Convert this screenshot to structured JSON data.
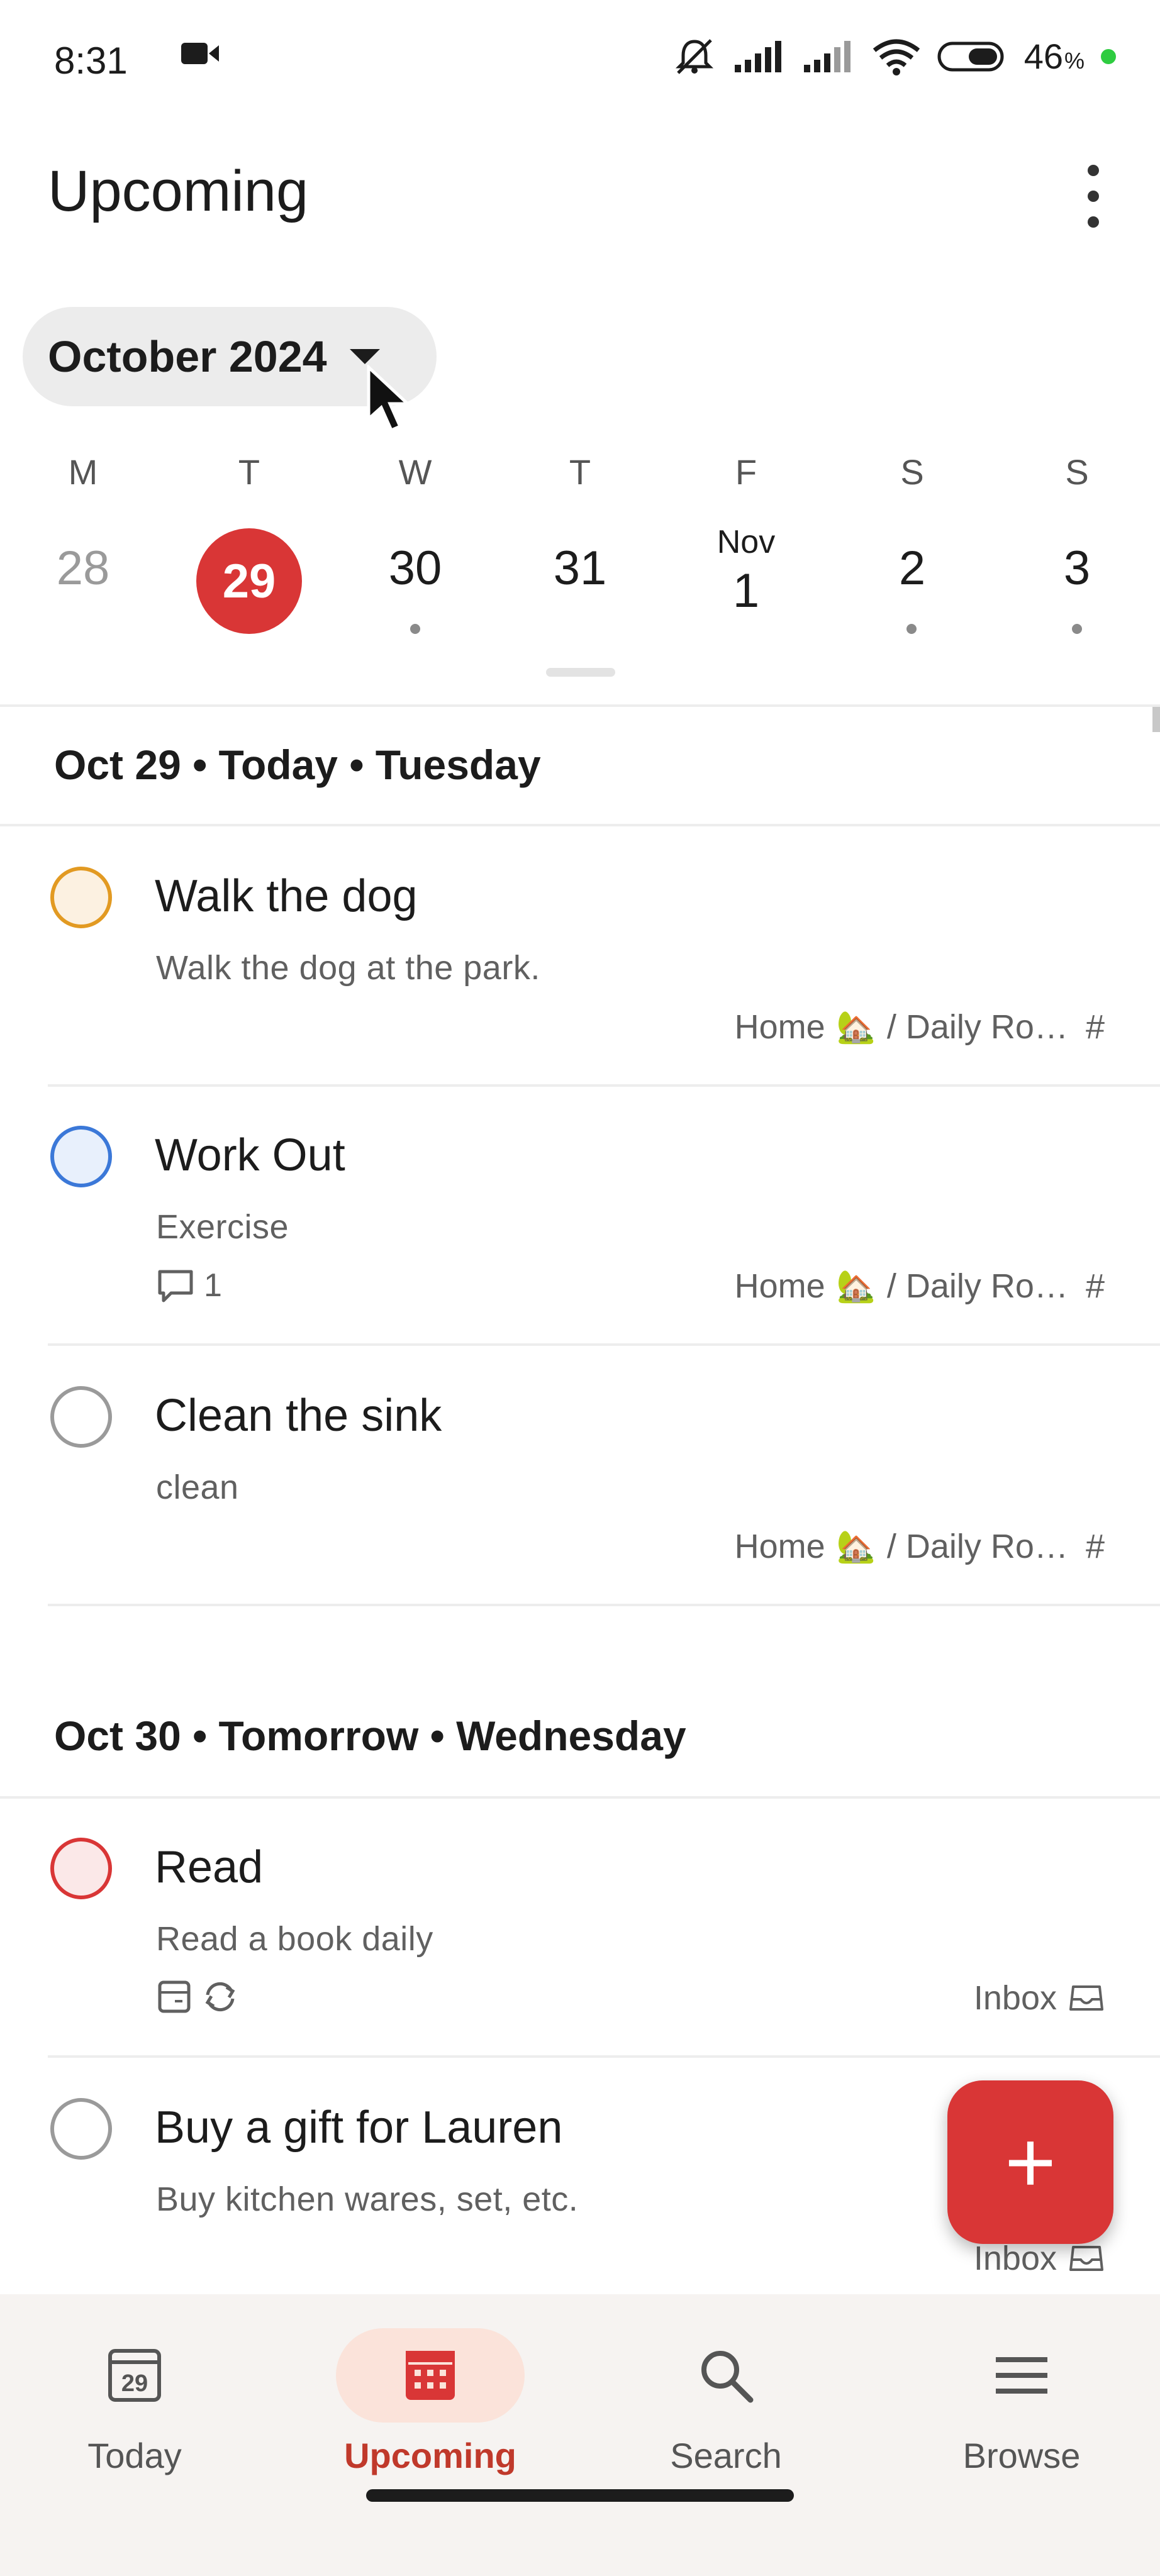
{
  "status_bar": {
    "time": "8:31",
    "battery": "46",
    "battery_unit": "%"
  },
  "header": {
    "title": "Upcoming"
  },
  "month_selector": {
    "label": "October 2024"
  },
  "week": {
    "days": [
      {
        "dow": "M",
        "date": "28"
      },
      {
        "dow": "T",
        "date": "29"
      },
      {
        "dow": "W",
        "date": "30"
      },
      {
        "dow": "T",
        "date": "31"
      },
      {
        "dow": "F",
        "month": "Nov",
        "date": "1"
      },
      {
        "dow": "S",
        "date": "2"
      },
      {
        "dow": "S",
        "date": "3"
      }
    ]
  },
  "sections": [
    {
      "heading": "Oct 29 • Today • Tuesday",
      "tasks": [
        {
          "title": "Walk the dog",
          "description": "Walk the dog at the park.",
          "project": "Home",
          "project_sub": "/ Daily Ro…",
          "priority_color": "#e29a22"
        },
        {
          "title": "Work Out",
          "description": "Exercise",
          "comments": "1",
          "project": "Home",
          "project_sub": "/ Daily Ro…",
          "priority_color": "#3b78d8"
        },
        {
          "title": "Clean the sink",
          "description": "clean",
          "project": "Home",
          "project_sub": "/ Daily Ro…",
          "priority_color": "#9a9a9a"
        }
      ]
    },
    {
      "heading": "Oct 30 • Tomorrow • Wednesday",
      "tasks": [
        {
          "title": "Read",
          "description": "Read a book daily",
          "project": "Inbox",
          "priority_color": "#d93636"
        },
        {
          "title": "Buy a gift for Lauren",
          "description": "Buy kitchen wares, set, etc.",
          "project": "Inbox",
          "priority_color": "#9a9a9a"
        }
      ]
    }
  ],
  "fab": {
    "label": "+"
  },
  "bottom_nav": {
    "items": [
      {
        "label": "Today",
        "icon": "calendar-day-icon",
        "badge": "29"
      },
      {
        "label": "Upcoming",
        "icon": "calendar-grid-icon"
      },
      {
        "label": "Search",
        "icon": "search-icon"
      },
      {
        "label": "Browse",
        "icon": "menu-icon"
      }
    ],
    "active": "Upcoming"
  },
  "colors": {
    "accent": "#d93636",
    "nav_active_bg": "#fbe3da"
  }
}
